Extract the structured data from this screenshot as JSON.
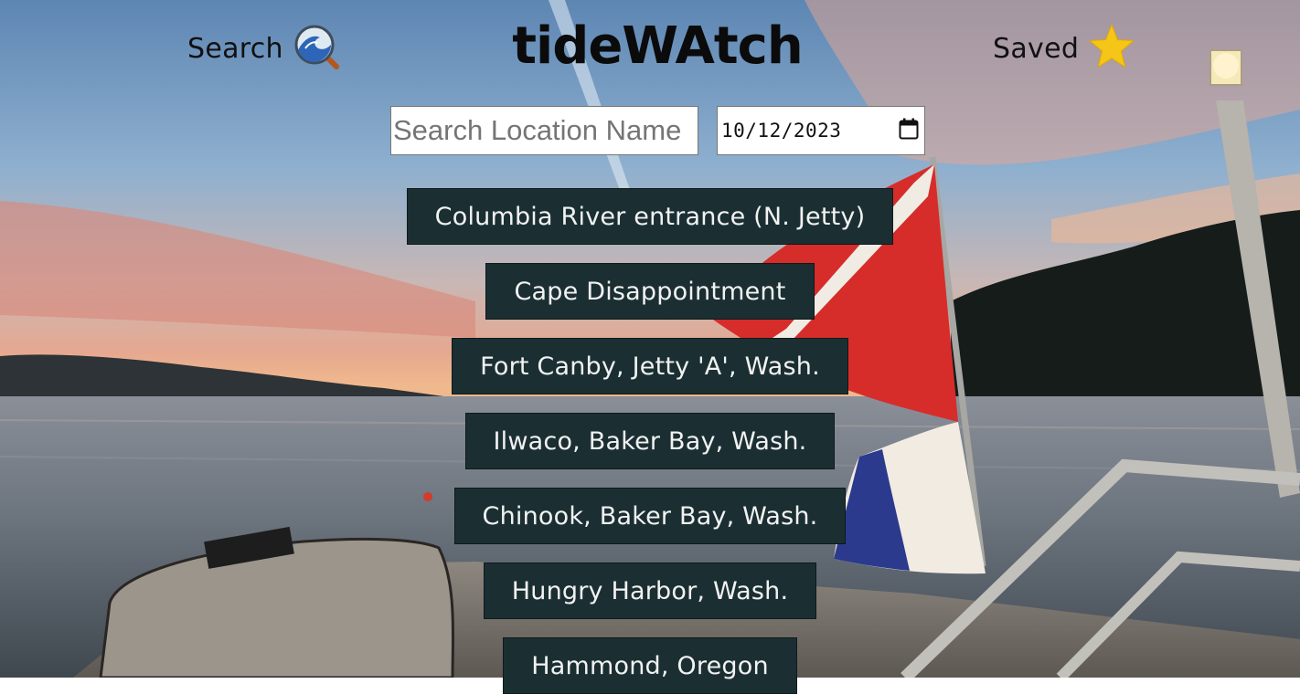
{
  "header": {
    "search_label": "Search",
    "search_icon": "wave-magnifier-icon",
    "logo": "tideWAtch",
    "saved_label": "Saved",
    "saved_icon": "star-icon",
    "saved_icon_color": "#f5c518"
  },
  "search": {
    "placeholder": "Search Location Name",
    "value": ""
  },
  "date": {
    "value": "10/12/2023",
    "icon": "calendar-icon"
  },
  "locations": [
    "Columbia River entrance (N. Jetty)",
    "Cape Disappointment",
    "Fort Canby, Jetty 'A', Wash.",
    "Ilwaco, Baker Bay, Wash.",
    "Chinook, Baker Bay, Wash.",
    "Hungry Harbor, Wash.",
    "Hammond, Oregon"
  ],
  "colors": {
    "button_bg": "#1b2f33",
    "button_text": "#f2f2f2"
  }
}
